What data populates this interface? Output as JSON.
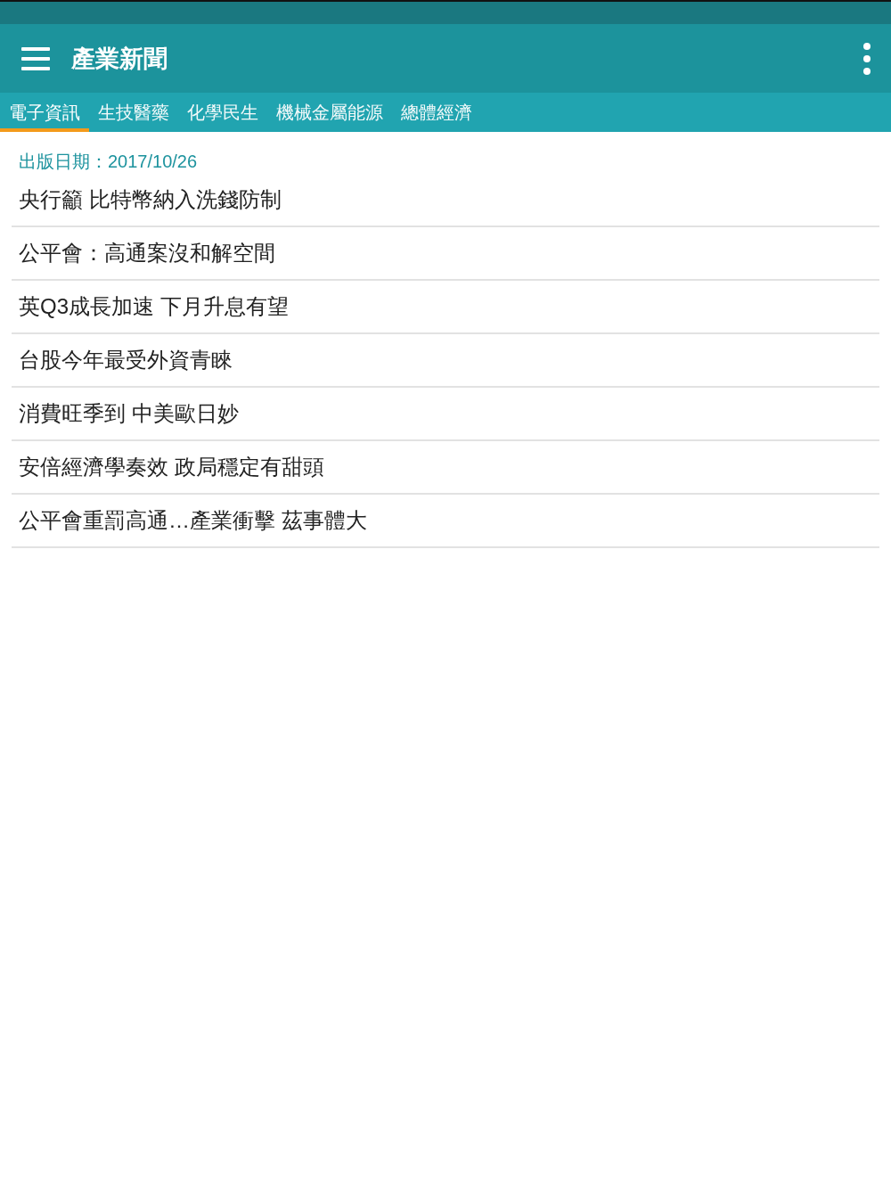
{
  "app_bar": {
    "title": "產業新聞"
  },
  "tabs": [
    {
      "label": "電子資訊",
      "selected": true
    },
    {
      "label": "生技醫藥",
      "selected": false
    },
    {
      "label": "化學民生",
      "selected": false
    },
    {
      "label": "機械金屬能源",
      "selected": false
    },
    {
      "label": "總體經濟",
      "selected": false
    }
  ],
  "publish_date": "出版日期：2017/10/26",
  "articles": [
    "央行籲 比特幣納入洗錢防制",
    "公平會：高通案沒和解空間",
    "英Q3成長加速 下月升息有望",
    "台股今年最受外資青睞",
    "消費旺季到 中美歐日妙",
    "安倍經濟學奏效 政局穩定有甜頭",
    "公平會重罰高通…產業衝擊 茲事體大"
  ]
}
